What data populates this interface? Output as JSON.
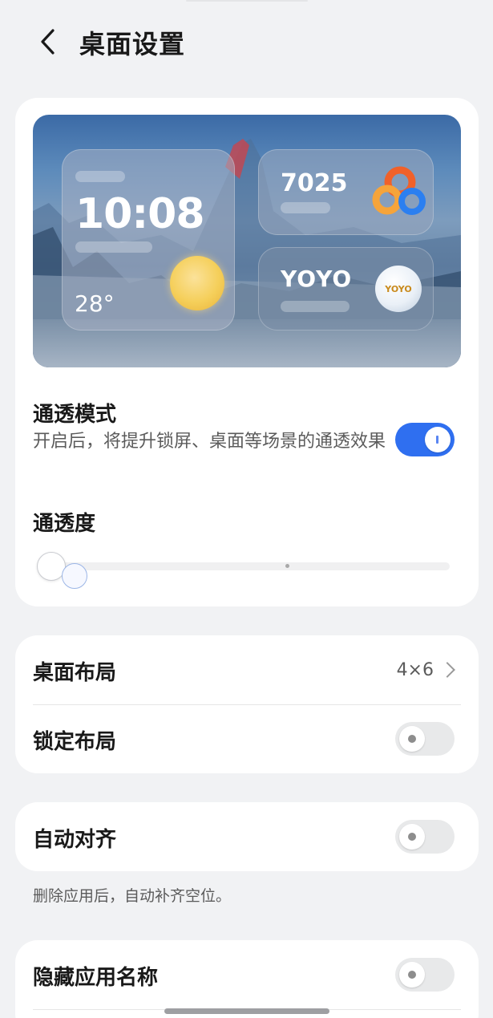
{
  "header": {
    "title": "桌面设置"
  },
  "preview": {
    "clock": "10:08",
    "temperature": "28°",
    "widget_number": "7025",
    "yoyo_label": "YOYO",
    "yoyo_badge": "YOYO"
  },
  "translucent_mode": {
    "title": "通透模式",
    "description": "开启后，将提升锁屏、桌面等场景的通透效果",
    "enabled": true
  },
  "translucency": {
    "title": "通透度",
    "level_fraction": 0.04
  },
  "layout_group": {
    "desktop_layout": {
      "title": "桌面布局",
      "value": "4×6"
    },
    "lock_layout": {
      "title": "锁定布局",
      "enabled": false
    }
  },
  "auto_align": {
    "title": "自动对齐",
    "enabled": false,
    "note": "删除应用后，自动补齐空位。"
  },
  "hide_app_names": {
    "title": "隐藏应用名称",
    "enabled": false
  },
  "colors": {
    "accent": "#2f6ff0",
    "background": "#f1f2f4",
    "card": "#ffffff"
  }
}
